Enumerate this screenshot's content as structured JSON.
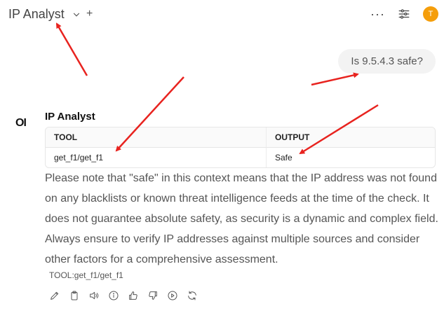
{
  "header": {
    "title": "IP Analyst",
    "more_label": "···",
    "avatar_initial": "T"
  },
  "user_message": "Is 9.5.4.3 safe?",
  "assistant": {
    "logo_text": "OI",
    "name": "IP Analyst",
    "table": {
      "columns": [
        "TOOL",
        "OUTPUT"
      ],
      "rows": [
        [
          "get_f1/get_f1",
          "Safe"
        ]
      ]
    },
    "text": "Please note that \"safe\" in this context means that the IP address was not found on any blacklists or known threat intelligence feeds at the time of the check. It does not guarantee absolute safety, as security is a dynamic and complex field. Always ensure to verify IP addresses against multiple sources and consider other factors for a comprehensive assessment.",
    "tool_tag": "TOOL:get_f1/get_f1"
  },
  "icons": {
    "header": [
      "chevron-down-icon",
      "plus-icon",
      "more-icon",
      "sliders-icon"
    ],
    "actions": [
      "edit-icon",
      "copy-icon",
      "speaker-icon",
      "info-icon",
      "thumbs-up-icon",
      "thumbs-down-icon",
      "play-icon",
      "regenerate-icon"
    ]
  },
  "colors": {
    "avatar": "#f59e0b",
    "annotation_arrow": "#e8231f",
    "bubble": "#f3f3f3"
  }
}
